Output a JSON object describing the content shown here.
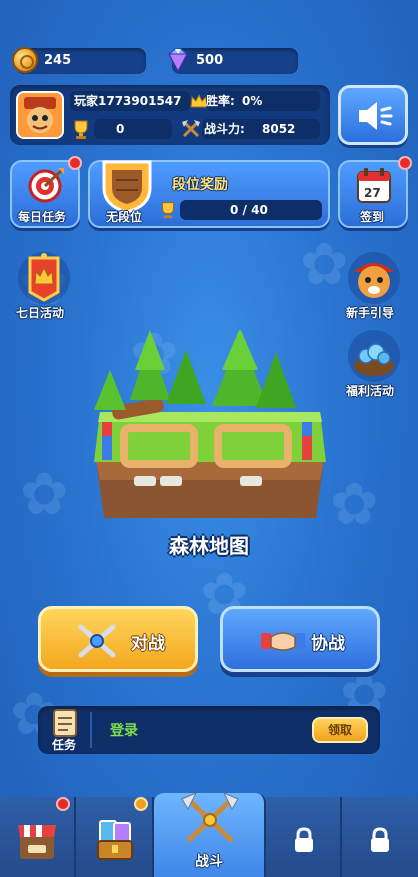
{
  "currency": {
    "coins": "245",
    "gems": "500"
  },
  "profile": {
    "name": "玩家1773901547",
    "win_rate_label": "胜率:",
    "win_rate_value": "0%",
    "trophies": "0",
    "power_label": "战斗力:",
    "power_value": "8052"
  },
  "tiles": {
    "daily_tasks": "每日任务",
    "rank_rewards_title": "段位奖励",
    "rank_name": "无段位",
    "rank_progress": "0 / 40",
    "checkin": "签到",
    "calendar_day": "27"
  },
  "side": {
    "seven_day": "七日活动",
    "newbie_guide": "新手引导",
    "welfare": "福利活动"
  },
  "map": {
    "name": "森林地图"
  },
  "buttons": {
    "battle": "对战",
    "coop": "协战"
  },
  "task_bar": {
    "icon_label": "任务",
    "task_text": "登录",
    "claim": "领取"
  },
  "nav": {
    "battle_tab": "战斗"
  },
  "colors": {
    "background": "#2a74d0",
    "battle_button": "#f3a71e",
    "coop_button": "#2f6fdc",
    "badge_red": "#e22b2b",
    "task_green": "#7fe04a"
  }
}
